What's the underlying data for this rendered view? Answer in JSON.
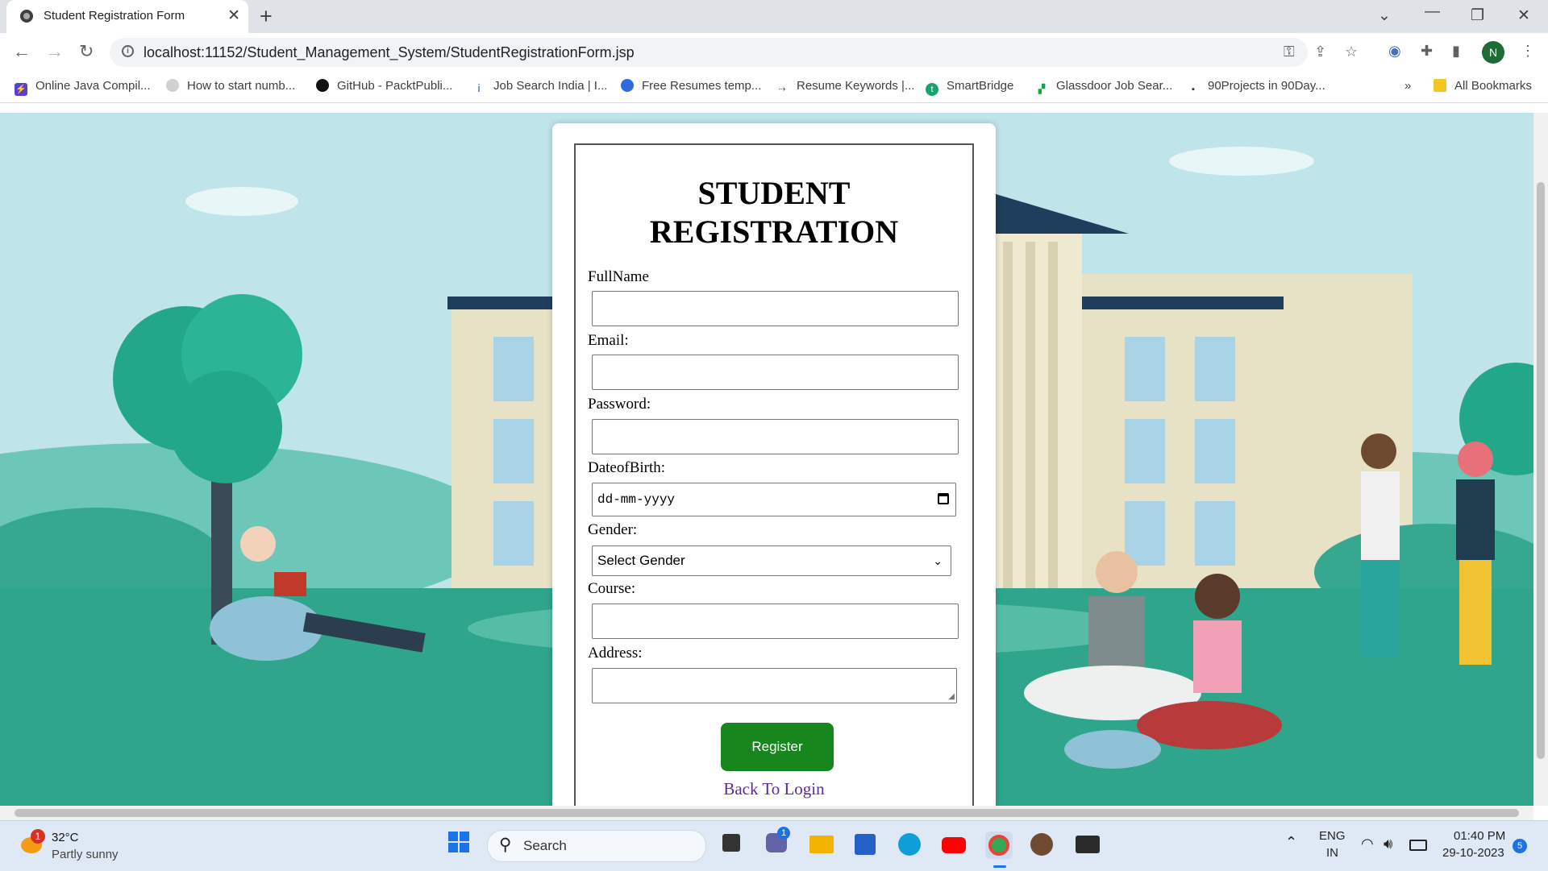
{
  "browser": {
    "tab_title": "Student Registration Form",
    "url": "localhost:11152/Student_Management_System/StudentRegistrationForm.jsp",
    "profile_initial": "N",
    "bookmarks": [
      "Online Java Compil...",
      "How to start numb...",
      "GitHub - PacktPubli...",
      "Job Search India | I...",
      "Free Resumes temp...",
      "Resume Keywords |...",
      "SmartBridge",
      "Glassdoor Job Sear...",
      "90Projects in 90Day..."
    ],
    "all_bookmarks": "All Bookmarks"
  },
  "form": {
    "title": "STUDENT REGISTRATION",
    "fullname_label": "FullName",
    "email_label": "Email:",
    "password_label": "Password:",
    "dob_label": "DateofBirth:",
    "dob_placeholder": "dd-mm-yyyy",
    "gender_label": "Gender:",
    "gender_selected": "Select Gender",
    "course_label": "Course:",
    "address_label": "Address:",
    "register_button": "Register",
    "back_link": "Back To Login"
  },
  "taskbar": {
    "weather_temp": "32°C",
    "weather_desc": "Partly sunny",
    "weather_badge": "1",
    "search_label": "Search",
    "teams_badge": "1",
    "lang_line1": "ENG",
    "lang_line2": "IN",
    "time": "01:40 PM",
    "date": "29-10-2023",
    "notification_count": "5"
  },
  "colors": {
    "register_green": "#17861d",
    "link_purple": "#5c2a9d",
    "sky": "#bfe4ea",
    "grass": "#2fa58c"
  }
}
